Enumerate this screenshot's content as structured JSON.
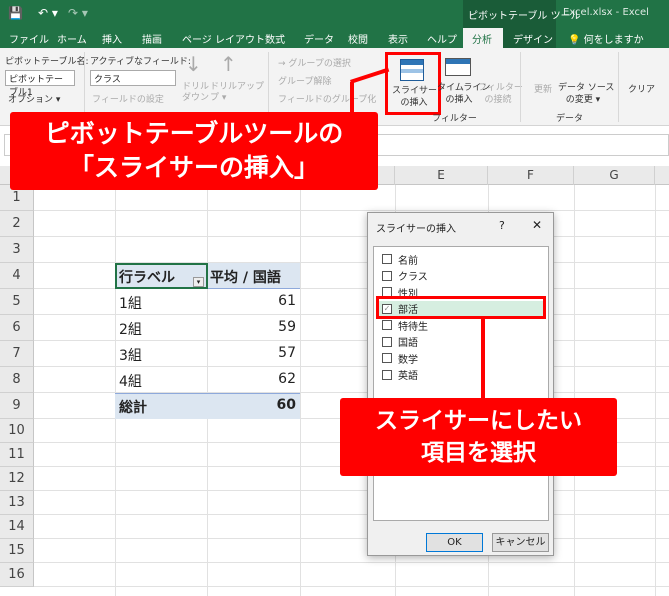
{
  "titlebar": {
    "quick_access": [
      "💾",
      "↶ ▾",
      "↷ ▾"
    ],
    "context_tool": "ピボットテーブル ツール",
    "title": "Excel.xlsx  -  Excel"
  },
  "tabs": [
    "ファイル",
    "ホーム",
    "挿入",
    "描画",
    "ページ レイアウト",
    "数式",
    "データ",
    "校閲",
    "表示",
    "ヘルプ",
    "分析",
    "デザイン",
    "何をしますか"
  ],
  "ribbon": {
    "pivot_name_label": "ピボットテーブル名:",
    "pivot_name_value": "ピボットテーブル1",
    "options": "オプション ▾",
    "active_field_label": "アクティブなフィールド:",
    "active_field_value": "クラス",
    "field_settings": "フィールドの設定",
    "drill_down": [
      "ドリル",
      "ダウン"
    ],
    "drill_up": [
      "ドリルアップ",
      "プ ▾"
    ],
    "group_selection": "→ グループの選択",
    "ungroup": "グループ解除",
    "group_field": "フィールドのグループ化",
    "insert_slicer": [
      "スライサー",
      "の挿入"
    ],
    "insert_timeline": [
      "タイムライン",
      "の挿入"
    ],
    "filter_connections": [
      "フィルター",
      "の接続"
    ],
    "filter_group": "フィルター",
    "refresh": "更新",
    "change_source": [
      "データ ソース",
      "の変更 ▾"
    ],
    "data_group": "データ",
    "clear": "クリア"
  },
  "columns": [
    "E",
    "F",
    "G"
  ],
  "rows": [
    "1",
    "2",
    "3",
    "4",
    "5",
    "6",
    "7",
    "8",
    "9",
    "10",
    "11",
    "12",
    "13",
    "14",
    "15",
    "16"
  ],
  "pivot": {
    "header_row_label": "行ラベル",
    "header_value": "平均 / 国語",
    "rows": [
      {
        "label": "1組",
        "value": "61"
      },
      {
        "label": "2組",
        "value": "59"
      },
      {
        "label": "3組",
        "value": "57"
      },
      {
        "label": "4組",
        "value": "62"
      }
    ],
    "total": {
      "label": "総計",
      "value": "60"
    }
  },
  "dialog": {
    "title": "スライサーの挿入",
    "help": "?",
    "close": "✕",
    "items": [
      {
        "label": "名前",
        "checked": false
      },
      {
        "label": "クラス",
        "checked": false
      },
      {
        "label": "性別",
        "checked": false
      },
      {
        "label": "部活",
        "checked": true
      },
      {
        "label": "特待生",
        "checked": false
      },
      {
        "label": "国語",
        "checked": false
      },
      {
        "label": "数学",
        "checked": false
      },
      {
        "label": "英語",
        "checked": false
      }
    ],
    "ok": "OK",
    "cancel": "キャンセル"
  },
  "callouts": {
    "top": [
      "ピボットテーブルツールの",
      "「スライサーの挿入」"
    ],
    "bottom": [
      "スライサーにしたい",
      "項目を選択"
    ]
  },
  "colors": {
    "excel_green": "#217346",
    "callout_red": "#ff0000",
    "selected_row": "#d6eee0"
  }
}
